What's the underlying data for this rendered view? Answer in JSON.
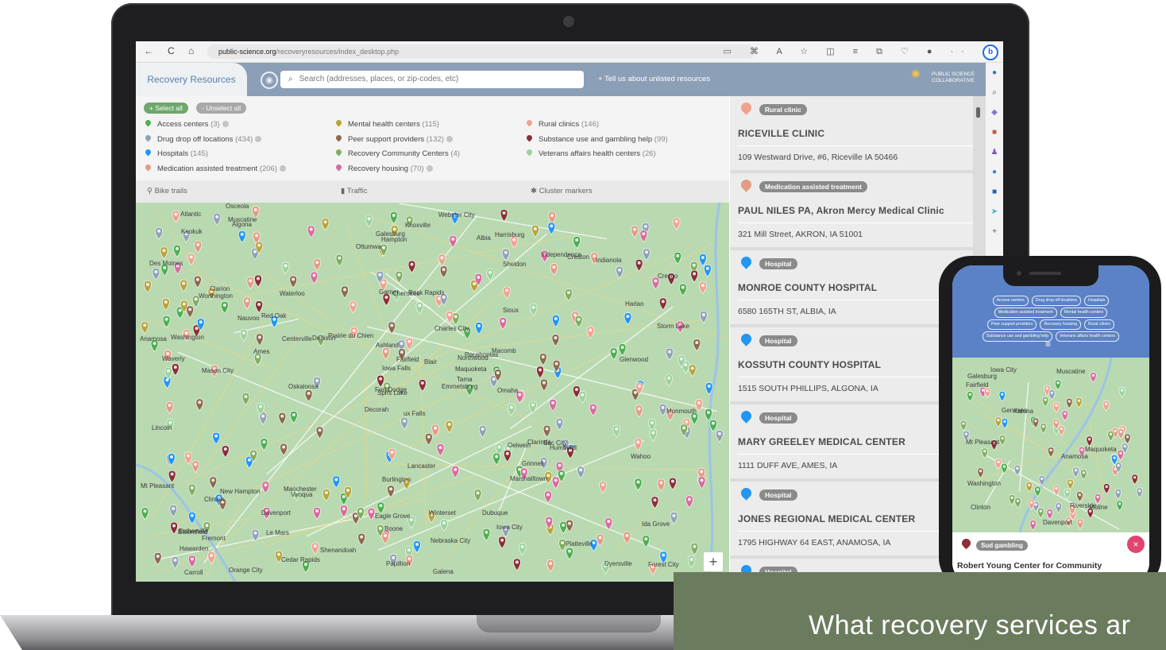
{
  "browser": {
    "url_domain": "public-science.org",
    "url_path": "/recoveryresources/index_desktop.php",
    "nav_back": "←",
    "nav_reload": "C",
    "nav_home": "⌂",
    "toolbar_icons": "▭ ⌘ A ☆ ◫ ≡ ⧉ ♡ ● ··",
    "bing": "b"
  },
  "app": {
    "title": "Recovery Resources",
    "search_placeholder": "Search   (addresses, places, or zip-codes, etc)",
    "tell_us": "+ Tell us about unlisted resources",
    "logo_line1": "PUBLIC SCIENCE",
    "logo_line2": "COLLABORATIVE"
  },
  "filters": {
    "select_all": "+ Select all",
    "unselect_all": "- Unselect all",
    "items": [
      {
        "label": "Access centers",
        "count": "(3)",
        "color": "#4caf50"
      },
      {
        "label": "Drug drop off locations",
        "count": "(434)",
        "color": "#8fa3b5"
      },
      {
        "label": "Hospitals",
        "count": "(145)",
        "color": "#2196f3"
      },
      {
        "label": "Medication assisted treatment",
        "count": "(206)",
        "color": "#e39b83"
      },
      {
        "label": "Mental health centers",
        "count": "(115)",
        "color": "#b8a43a"
      },
      {
        "label": "Peer support providers",
        "count": "(132)",
        "color": "#8b6a4d"
      },
      {
        "label": "Recovery Community Centers",
        "count": "(4)",
        "color": "#7fae5f"
      },
      {
        "label": "Recovery housing",
        "count": "(70)",
        "color": "#d96a9c"
      },
      {
        "label": "Rural clinics",
        "count": "(146)",
        "color": "#f0a28f"
      },
      {
        "label": "Substance use and gambling help",
        "count": "(99)",
        "color": "#8a2f36"
      },
      {
        "label": "Veterans affairs health centers",
        "count": "(26)",
        "color": "#9bd39a"
      }
    ]
  },
  "layers": {
    "bike": "Bike trails",
    "traffic": "Traffic",
    "cluster": "Cluster markers"
  },
  "map": {
    "zoom_in": "+",
    "labels": [
      "ux Falls",
      "Worthington",
      "Spirit Lake",
      "Estherville",
      "Northwood",
      "Viroqua",
      "Harrisburg",
      "Rock Rapids",
      "Sheldon",
      "Emmetsburg",
      "Algona",
      "Forest City",
      "Mason City",
      "Cresco",
      "Decorah",
      "Sioux",
      "Orange City",
      "Garner",
      "Charles City",
      "New Hampton",
      "Prairie du Chien",
      "Hawarden",
      "Le Mars",
      "Cherokee",
      "Pocahontas",
      "Humboldt",
      "Clarion",
      "Hampton",
      "Waverly",
      "Oelwein",
      "Storm Lake",
      "Fort Dodge",
      "Eagle Grove",
      "Iowa Falls",
      "Waterloo",
      "Independence",
      "Manchester",
      "Dyersville",
      "Ida Grove",
      "Sac City",
      "Webster City",
      "Denison",
      "Ames",
      "Marshalltown",
      "Cedar Rapids",
      "Anamosa",
      "Maquoketa",
      "Carroll",
      "Boone",
      "Tama",
      "Clinton",
      "Harlan",
      "Des Moines",
      "Grinnell",
      "Iowa City",
      "Davenport",
      "Muscatine",
      "Atlantic",
      "Winterset",
      "Indianola",
      "Knoxville",
      "Oskaloosa",
      "Washington",
      "Red Oak",
      "Creston",
      "Osceola",
      "Albia",
      "Ottumwa",
      "Fairfield",
      "Mt Pleasant",
      "Burlington",
      "Shenandoah",
      "Clarinda",
      "Centerville",
      "Bloomfield",
      "Keokuk",
      "Nauvoo",
      "Lincoln",
      "Ashland",
      "Nebraska City",
      "Blair",
      "Fremont",
      "Omaha",
      "Wahoo",
      "Papillion",
      "Glenwood",
      "Lancaster",
      "Platteville",
      "Galena",
      "Dubuque",
      "Galesburg",
      "Monmouth",
      "Macomb"
    ]
  },
  "results": [
    {
      "badge": "Rural clinic",
      "name": "RICEVILLE CLINIC",
      "address": "109 Westward Drive, #6, Riceville IA 50466",
      "color": "#f0a28f"
    },
    {
      "badge": "Medication assisted treatment",
      "name": "PAUL NILES PA, Akron Mercy Medical Clinic",
      "address": "321 Mill Street, AKRON, IA 51001",
      "color": "#e39b83"
    },
    {
      "badge": "Hospital",
      "name": "MONROE COUNTY HOSPITAL",
      "address": "6580 165TH ST, ALBIA, IA",
      "color": "#2196f3"
    },
    {
      "badge": "Hospital",
      "name": "KOSSUTH COUNTY HOSPITAL",
      "address": "1515 SOUTH PHILLIPS, ALGONA, IA",
      "color": "#2196f3"
    },
    {
      "badge": "Hospital",
      "name": "MARY GREELEY MEDICAL CENTER",
      "address": "1111 DUFF AVE, AMES, IA",
      "color": "#2196f3"
    },
    {
      "badge": "Hospital",
      "name": "JONES REGIONAL MEDICAL CENTER",
      "address": "1795 HIGHWAY 64 EAST, ANAMOSA, IA",
      "color": "#2196f3"
    },
    {
      "badge": "Hospital",
      "name": "",
      "address": "",
      "color": "#2196f3"
    }
  ],
  "phone": {
    "chips": [
      "Access centers",
      "Drug drop off locations",
      "Hospitals",
      "Medication assisted treatment",
      "Mental health centers",
      "Peer support providers",
      "Recovery housing",
      "Rural clinics",
      "Substance use and gambling help",
      "Veterans affairs health centers"
    ],
    "menu_icon": "≡",
    "labels": [
      "Anamosa",
      "Maquoketa",
      "Clinton",
      "Iowa City",
      "Kalona",
      "Riverside",
      "Washington",
      "Muscatine",
      "Geneseo",
      "Davenport",
      "Fairfield",
      "Mt Pleasant",
      "Galesburg",
      "Moline"
    ],
    "card_badge": "Sud gambling",
    "card_name": "Robert Young Center for Community",
    "card_close": "×"
  },
  "banner": {
    "text": "What recovery services ar"
  }
}
